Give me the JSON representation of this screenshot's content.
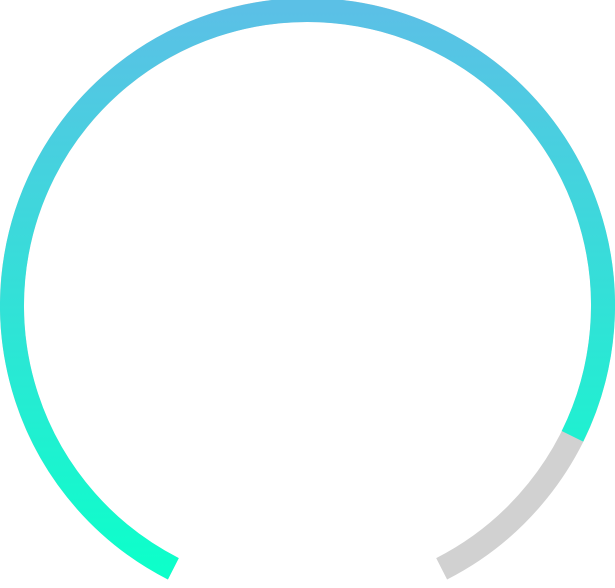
{
  "gauge": {
    "progress": 0.88,
    "colors": {
      "gradient_top": "#5bc0e6",
      "gradient_bottom": "#0dffca",
      "track": "#d1d1d1"
    }
  }
}
